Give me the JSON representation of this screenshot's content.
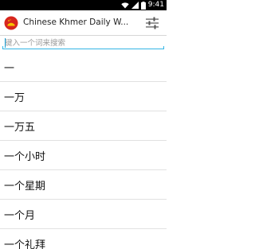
{
  "status_bar": {
    "time": "9:41",
    "icons": [
      "wifi-icon",
      "signal-icon",
      "battery-icon"
    ]
  },
  "app_bar": {
    "icon": "app-flag-icon",
    "title": "Chinese Khmer Daily W...",
    "settings_icon": "sliders-icon"
  },
  "search": {
    "placeholder": "键入一个词来搜索",
    "value": ""
  },
  "words": [
    "一",
    "一万",
    "一万五",
    "一个小时",
    "一个星期",
    "一个月",
    "一个礼拜"
  ],
  "colors": {
    "status_bar_bg": "#000000",
    "accent": "#33b5e5",
    "app_icon_red": "#d7261e",
    "divider": "#e1e1e1"
  }
}
